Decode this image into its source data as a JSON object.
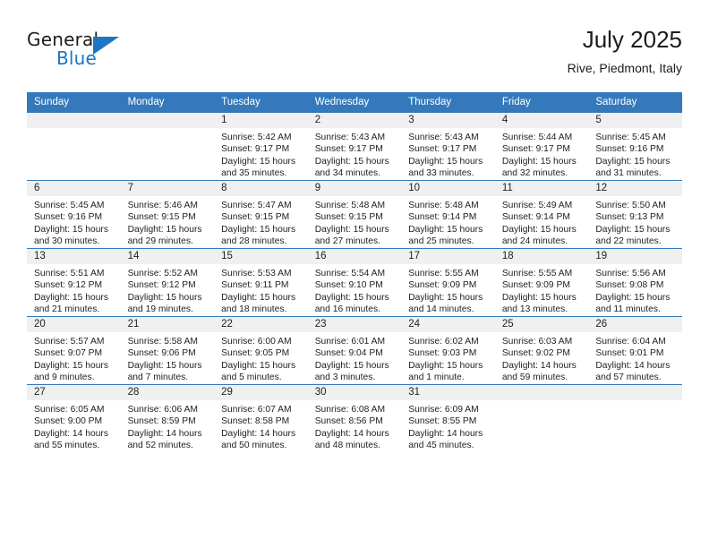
{
  "brand": {
    "name_top": "General",
    "name_bottom": "Blue",
    "accent_color": "#1c76c4",
    "triangle_icon": "brand-triangle-icon"
  },
  "header": {
    "title": "July 2025",
    "location": "Rive, Piedmont, Italy"
  },
  "theme": {
    "header_row_bg": "#3479bb",
    "daynum_band_bg": "#f0f0f0",
    "row_border": "#3479bb",
    "text": "#222222"
  },
  "weekday_headers": [
    "Sunday",
    "Monday",
    "Tuesday",
    "Wednesday",
    "Thursday",
    "Friday",
    "Saturday"
  ],
  "weeks": [
    [
      {
        "day": "",
        "sunrise": "",
        "sunset": "",
        "daylight_1": "",
        "daylight_2": ""
      },
      {
        "day": "",
        "sunrise": "",
        "sunset": "",
        "daylight_1": "",
        "daylight_2": ""
      },
      {
        "day": "1",
        "sunrise": "Sunrise: 5:42 AM",
        "sunset": "Sunset: 9:17 PM",
        "daylight_1": "Daylight: 15 hours",
        "daylight_2": "and 35 minutes."
      },
      {
        "day": "2",
        "sunrise": "Sunrise: 5:43 AM",
        "sunset": "Sunset: 9:17 PM",
        "daylight_1": "Daylight: 15 hours",
        "daylight_2": "and 34 minutes."
      },
      {
        "day": "3",
        "sunrise": "Sunrise: 5:43 AM",
        "sunset": "Sunset: 9:17 PM",
        "daylight_1": "Daylight: 15 hours",
        "daylight_2": "and 33 minutes."
      },
      {
        "day": "4",
        "sunrise": "Sunrise: 5:44 AM",
        "sunset": "Sunset: 9:17 PM",
        "daylight_1": "Daylight: 15 hours",
        "daylight_2": "and 32 minutes."
      },
      {
        "day": "5",
        "sunrise": "Sunrise: 5:45 AM",
        "sunset": "Sunset: 9:16 PM",
        "daylight_1": "Daylight: 15 hours",
        "daylight_2": "and 31 minutes."
      }
    ],
    [
      {
        "day": "6",
        "sunrise": "Sunrise: 5:45 AM",
        "sunset": "Sunset: 9:16 PM",
        "daylight_1": "Daylight: 15 hours",
        "daylight_2": "and 30 minutes."
      },
      {
        "day": "7",
        "sunrise": "Sunrise: 5:46 AM",
        "sunset": "Sunset: 9:15 PM",
        "daylight_1": "Daylight: 15 hours",
        "daylight_2": "and 29 minutes."
      },
      {
        "day": "8",
        "sunrise": "Sunrise: 5:47 AM",
        "sunset": "Sunset: 9:15 PM",
        "daylight_1": "Daylight: 15 hours",
        "daylight_2": "and 28 minutes."
      },
      {
        "day": "9",
        "sunrise": "Sunrise: 5:48 AM",
        "sunset": "Sunset: 9:15 PM",
        "daylight_1": "Daylight: 15 hours",
        "daylight_2": "and 27 minutes."
      },
      {
        "day": "10",
        "sunrise": "Sunrise: 5:48 AM",
        "sunset": "Sunset: 9:14 PM",
        "daylight_1": "Daylight: 15 hours",
        "daylight_2": "and 25 minutes."
      },
      {
        "day": "11",
        "sunrise": "Sunrise: 5:49 AM",
        "sunset": "Sunset: 9:14 PM",
        "daylight_1": "Daylight: 15 hours",
        "daylight_2": "and 24 minutes."
      },
      {
        "day": "12",
        "sunrise": "Sunrise: 5:50 AM",
        "sunset": "Sunset: 9:13 PM",
        "daylight_1": "Daylight: 15 hours",
        "daylight_2": "and 22 minutes."
      }
    ],
    [
      {
        "day": "13",
        "sunrise": "Sunrise: 5:51 AM",
        "sunset": "Sunset: 9:12 PM",
        "daylight_1": "Daylight: 15 hours",
        "daylight_2": "and 21 minutes."
      },
      {
        "day": "14",
        "sunrise": "Sunrise: 5:52 AM",
        "sunset": "Sunset: 9:12 PM",
        "daylight_1": "Daylight: 15 hours",
        "daylight_2": "and 19 minutes."
      },
      {
        "day": "15",
        "sunrise": "Sunrise: 5:53 AM",
        "sunset": "Sunset: 9:11 PM",
        "daylight_1": "Daylight: 15 hours",
        "daylight_2": "and 18 minutes."
      },
      {
        "day": "16",
        "sunrise": "Sunrise: 5:54 AM",
        "sunset": "Sunset: 9:10 PM",
        "daylight_1": "Daylight: 15 hours",
        "daylight_2": "and 16 minutes."
      },
      {
        "day": "17",
        "sunrise": "Sunrise: 5:55 AM",
        "sunset": "Sunset: 9:09 PM",
        "daylight_1": "Daylight: 15 hours",
        "daylight_2": "and 14 minutes."
      },
      {
        "day": "18",
        "sunrise": "Sunrise: 5:55 AM",
        "sunset": "Sunset: 9:09 PM",
        "daylight_1": "Daylight: 15 hours",
        "daylight_2": "and 13 minutes."
      },
      {
        "day": "19",
        "sunrise": "Sunrise: 5:56 AM",
        "sunset": "Sunset: 9:08 PM",
        "daylight_1": "Daylight: 15 hours",
        "daylight_2": "and 11 minutes."
      }
    ],
    [
      {
        "day": "20",
        "sunrise": "Sunrise: 5:57 AM",
        "sunset": "Sunset: 9:07 PM",
        "daylight_1": "Daylight: 15 hours",
        "daylight_2": "and 9 minutes."
      },
      {
        "day": "21",
        "sunrise": "Sunrise: 5:58 AM",
        "sunset": "Sunset: 9:06 PM",
        "daylight_1": "Daylight: 15 hours",
        "daylight_2": "and 7 minutes."
      },
      {
        "day": "22",
        "sunrise": "Sunrise: 6:00 AM",
        "sunset": "Sunset: 9:05 PM",
        "daylight_1": "Daylight: 15 hours",
        "daylight_2": "and 5 minutes."
      },
      {
        "day": "23",
        "sunrise": "Sunrise: 6:01 AM",
        "sunset": "Sunset: 9:04 PM",
        "daylight_1": "Daylight: 15 hours",
        "daylight_2": "and 3 minutes."
      },
      {
        "day": "24",
        "sunrise": "Sunrise: 6:02 AM",
        "sunset": "Sunset: 9:03 PM",
        "daylight_1": "Daylight: 15 hours",
        "daylight_2": "and 1 minute."
      },
      {
        "day": "25",
        "sunrise": "Sunrise: 6:03 AM",
        "sunset": "Sunset: 9:02 PM",
        "daylight_1": "Daylight: 14 hours",
        "daylight_2": "and 59 minutes."
      },
      {
        "day": "26",
        "sunrise": "Sunrise: 6:04 AM",
        "sunset": "Sunset: 9:01 PM",
        "daylight_1": "Daylight: 14 hours",
        "daylight_2": "and 57 minutes."
      }
    ],
    [
      {
        "day": "27",
        "sunrise": "Sunrise: 6:05 AM",
        "sunset": "Sunset: 9:00 PM",
        "daylight_1": "Daylight: 14 hours",
        "daylight_2": "and 55 minutes."
      },
      {
        "day": "28",
        "sunrise": "Sunrise: 6:06 AM",
        "sunset": "Sunset: 8:59 PM",
        "daylight_1": "Daylight: 14 hours",
        "daylight_2": "and 52 minutes."
      },
      {
        "day": "29",
        "sunrise": "Sunrise: 6:07 AM",
        "sunset": "Sunset: 8:58 PM",
        "daylight_1": "Daylight: 14 hours",
        "daylight_2": "and 50 minutes."
      },
      {
        "day": "30",
        "sunrise": "Sunrise: 6:08 AM",
        "sunset": "Sunset: 8:56 PM",
        "daylight_1": "Daylight: 14 hours",
        "daylight_2": "and 48 minutes."
      },
      {
        "day": "31",
        "sunrise": "Sunrise: 6:09 AM",
        "sunset": "Sunset: 8:55 PM",
        "daylight_1": "Daylight: 14 hours",
        "daylight_2": "and 45 minutes."
      },
      {
        "day": "",
        "sunrise": "",
        "sunset": "",
        "daylight_1": "",
        "daylight_2": ""
      },
      {
        "day": "",
        "sunrise": "",
        "sunset": "",
        "daylight_1": "",
        "daylight_2": ""
      }
    ]
  ]
}
